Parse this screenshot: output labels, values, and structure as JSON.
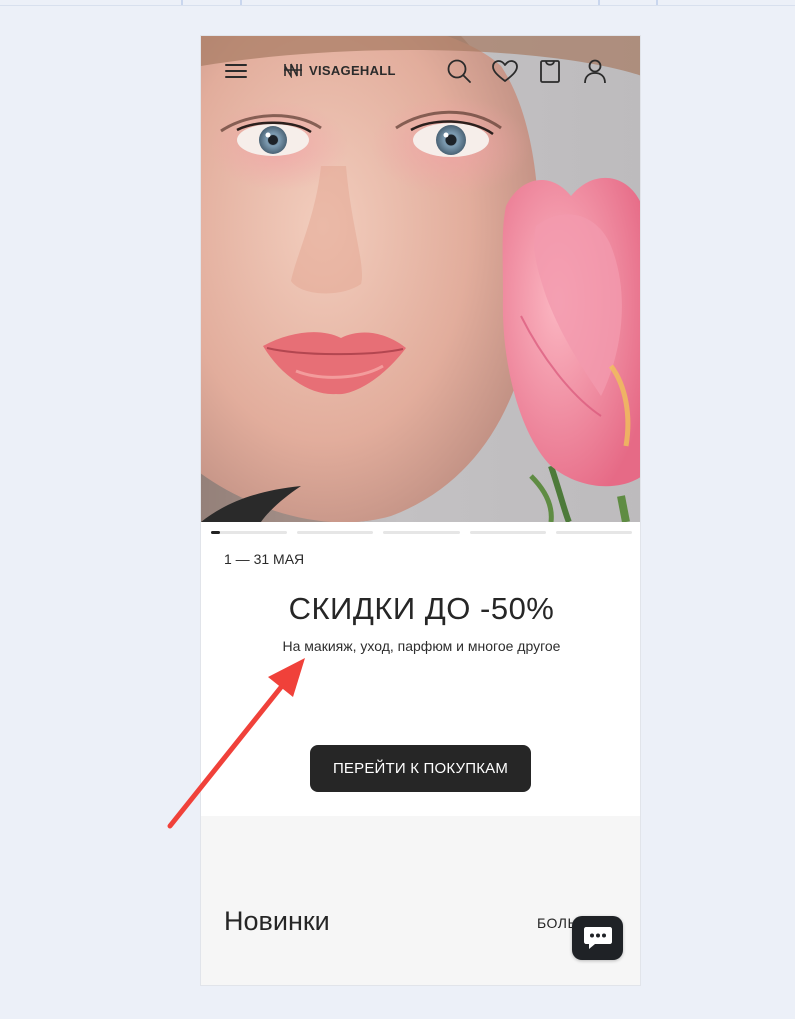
{
  "header": {
    "logo_text": "VISAGEHALL",
    "icons": [
      "menu-icon",
      "search-icon",
      "heart-icon",
      "bag-icon",
      "user-icon"
    ]
  },
  "hero": {
    "slides_count": 5,
    "active_slide": 1
  },
  "promo": {
    "date": "1 — 31 МАЯ",
    "title": "СКИДКИ ДО -50%",
    "subtitle": "На макияж, уход, парфюм и многое другое",
    "cta_label": "ПЕРЕЙТИ К ПОКУПКАМ"
  },
  "new_section": {
    "title": "Новинки",
    "more_label": "БОЛЬ"
  },
  "chat": {
    "icon": "chat-icon"
  },
  "colors": {
    "page_bg": "#ecf0f8",
    "button_bg": "#262626",
    "annotation_arrow": "#f0413a"
  }
}
